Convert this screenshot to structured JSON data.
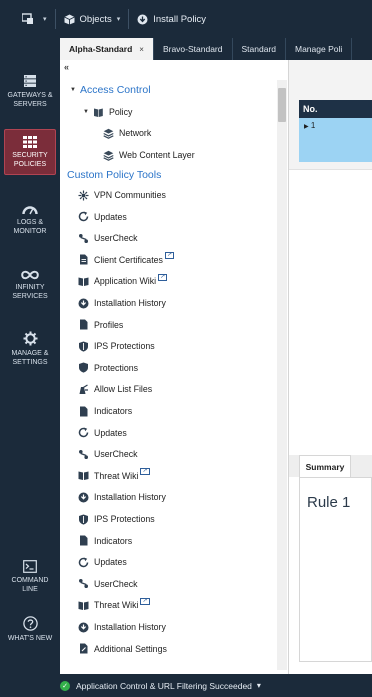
{
  "toolbar": {
    "objects_label": "Objects",
    "install_label": "Install Policy"
  },
  "nav": {
    "gateways": "GATEWAYS & SERVERS",
    "security": "SECURITY POLICIES",
    "logs": "LOGS & MONITOR",
    "infinity": "INFINITY SERVICES",
    "manage": "MANAGE & SETTINGS",
    "command": "COMMAND LINE",
    "whatsnew": "WHAT'S NEW"
  },
  "tabs": [
    "Alpha-Standard",
    "Bravo-Standard",
    "Standard",
    "Manage Poli"
  ],
  "tab_close": "×",
  "tree": {
    "collapse": "«",
    "access_control": "Access Control",
    "policy": "Policy",
    "network": "Network",
    "web_content_layer": "Web Content Layer",
    "custom_tools": "Custom Policy Tools",
    "items": [
      {
        "label": "VPN Communities",
        "icon": "vpn-icon",
        "ext": false
      },
      {
        "label": "Updates",
        "icon": "updates-icon",
        "ext": false
      },
      {
        "label": "UserCheck",
        "icon": "usercheck-icon",
        "ext": false
      },
      {
        "label": "Client Certificates",
        "icon": "certificate-icon",
        "ext": true
      },
      {
        "label": "Application Wiki",
        "icon": "wiki-icon",
        "ext": true
      },
      {
        "label": "Installation History",
        "icon": "history-icon",
        "ext": false
      },
      {
        "label": "Profiles",
        "icon": "profiles-icon",
        "ext": false
      },
      {
        "label": "IPS Protections",
        "icon": "ips-icon",
        "ext": false
      },
      {
        "label": "Protections",
        "icon": "shield-icon",
        "ext": false
      },
      {
        "label": "Allow List Files",
        "icon": "allow-list-icon",
        "ext": false
      },
      {
        "label": "Indicators",
        "icon": "indicators-icon",
        "ext": false
      },
      {
        "label": "Updates",
        "icon": "updates-icon",
        "ext": false
      },
      {
        "label": "UserCheck",
        "icon": "usercheck-icon",
        "ext": false
      },
      {
        "label": "Threat Wiki",
        "icon": "wiki-icon",
        "ext": true
      },
      {
        "label": "Installation History",
        "icon": "history-icon",
        "ext": false
      },
      {
        "label": "IPS Protections",
        "icon": "ips-icon",
        "ext": false
      },
      {
        "label": "Indicators",
        "icon": "indicators-icon",
        "ext": false
      },
      {
        "label": "Updates",
        "icon": "updates-icon",
        "ext": false
      },
      {
        "label": "UserCheck",
        "icon": "usercheck-icon",
        "ext": false
      },
      {
        "label": "Threat Wiki",
        "icon": "wiki-icon",
        "ext": true
      },
      {
        "label": "Installation History",
        "icon": "history-icon",
        "ext": false
      },
      {
        "label": "Additional Settings",
        "icon": "settings-icon",
        "ext": false
      }
    ]
  },
  "grid": {
    "col_no": "No.",
    "row_no": "1"
  },
  "summary": {
    "tab_label": "Summary",
    "rule_title": "Rule 1"
  },
  "status": {
    "message": "Application Control & URL Filtering Succeeded",
    "caret": "▾"
  },
  "colors": {
    "navy": "#1b2a3a",
    "accent_blue": "#2b74c8",
    "active_nav": "#7b2d3a",
    "selected_row": "#9cd3f3",
    "success": "#33b04a"
  }
}
